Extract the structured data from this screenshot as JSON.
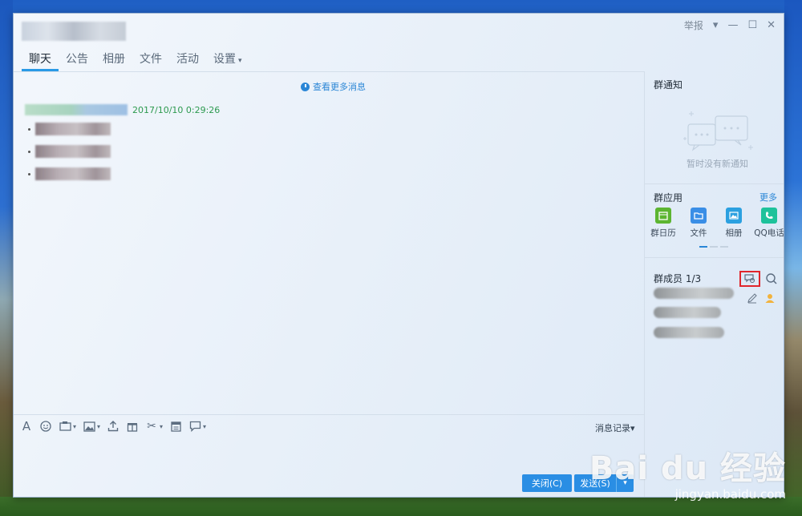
{
  "window": {
    "report_label": "举报",
    "dropdown_icon": "chevron-down-icon",
    "minimize_icon": "minimize-icon",
    "maximize_icon": "maximize-icon",
    "close_icon": "close-icon"
  },
  "tabs": [
    {
      "label": "聊天",
      "active": true
    },
    {
      "label": "公告",
      "active": false
    },
    {
      "label": "相册",
      "active": false
    },
    {
      "label": "文件",
      "active": false
    },
    {
      "label": "活动",
      "active": false
    },
    {
      "label": "设置",
      "active": false,
      "has_dropdown": true
    }
  ],
  "chat": {
    "view_more_label": "查看更多消息",
    "message_time": "2017/10/10 0:29:26"
  },
  "toolbar": {
    "icons": [
      "font-icon",
      "emoji-icon",
      "screenshot-icon",
      "image-icon",
      "upload-icon",
      "gift-icon",
      "scissors-icon",
      "clipboard-icon",
      "chat-bubble-icon"
    ],
    "history_label": "消息记录",
    "history_caret": "▾"
  },
  "buttons": {
    "close_label": "关闭(C)",
    "send_label": "发送(S)",
    "send_arrow": "▾"
  },
  "side": {
    "notice_title": "群通知",
    "notice_empty": "暂时没有新通知",
    "apps_title": "群应用",
    "apps_more": "更多",
    "apps": [
      {
        "label": "群日历",
        "icon": "calendar-icon",
        "color": "#5cb531"
      },
      {
        "label": "文件",
        "icon": "folder-icon",
        "color": "#3a8ee6"
      },
      {
        "label": "相册",
        "icon": "photo-icon",
        "color": "#2ba0e0"
      },
      {
        "label": "QQ电话",
        "icon": "phone-icon",
        "color": "#1ec29b"
      }
    ],
    "members_title": "群成员 1/3"
  },
  "watermark": {
    "brand": "Bai du 经验",
    "url": "jingyan.baidu.com"
  },
  "colors": {
    "accent": "#2a8ee4",
    "highlight_box": "#e0262c",
    "timestamp": "#2d9a4f"
  }
}
